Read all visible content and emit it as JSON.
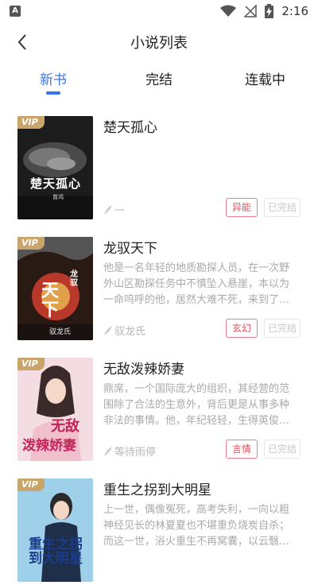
{
  "status_bar": {
    "time": "2:16",
    "notification_icon": "A"
  },
  "nav": {
    "title": "小说列表"
  },
  "tabs": [
    {
      "label": "新书",
      "active": true
    },
    {
      "label": "完结",
      "active": false
    },
    {
      "label": "连载中",
      "active": false
    }
  ],
  "books": [
    {
      "title": "楚天孤心",
      "description": "",
      "author": "一",
      "genre": "异能",
      "status": "已完结",
      "badge": "VIP",
      "cover_text": "楚天孤心",
      "cover_author": "曾鸿"
    },
    {
      "title": "龙驭天下",
      "description": "他是一名年轻的地质勘探人员，在一次野外山区勘探任务中不慎坠入悬崖，本以为一命呜呼的他，居然大难不死，来到了…",
      "author": "驭龙氏",
      "genre": "玄幻",
      "status": "已完结",
      "badge": "VIP",
      "cover_text": "天下",
      "cover_small": "龙驭",
      "cover_author": "驭龙氏"
    },
    {
      "title": "无敌泼辣娇妻",
      "description": "鼎席，一个国际庞大的组织，其经营的范围除了合法的生意外，背后更是从事多种非法的事情。他，年纪轻轻，生得英俊…",
      "author": "等待雨停",
      "genre": "言情",
      "status": "已完结",
      "badge": "VIP",
      "cover_text_1": "无敌",
      "cover_text_2": "泼辣娇妻"
    },
    {
      "title": "重生之拐到大明星",
      "description": "上一世，偶像冤死，高考失利，一向以粗神经见长的林夏夏也不堪重负烧炭自杀；而这一世，浴火重生不再窝囊，以云翳…",
      "author": "",
      "genre": "",
      "status": "",
      "badge": "VIP",
      "cover_text": "重生之拐到大明星"
    }
  ],
  "colors": {
    "accent": "#3b74e8",
    "genre_tag": "#e0505f",
    "vip_badge": "#caa56b"
  }
}
